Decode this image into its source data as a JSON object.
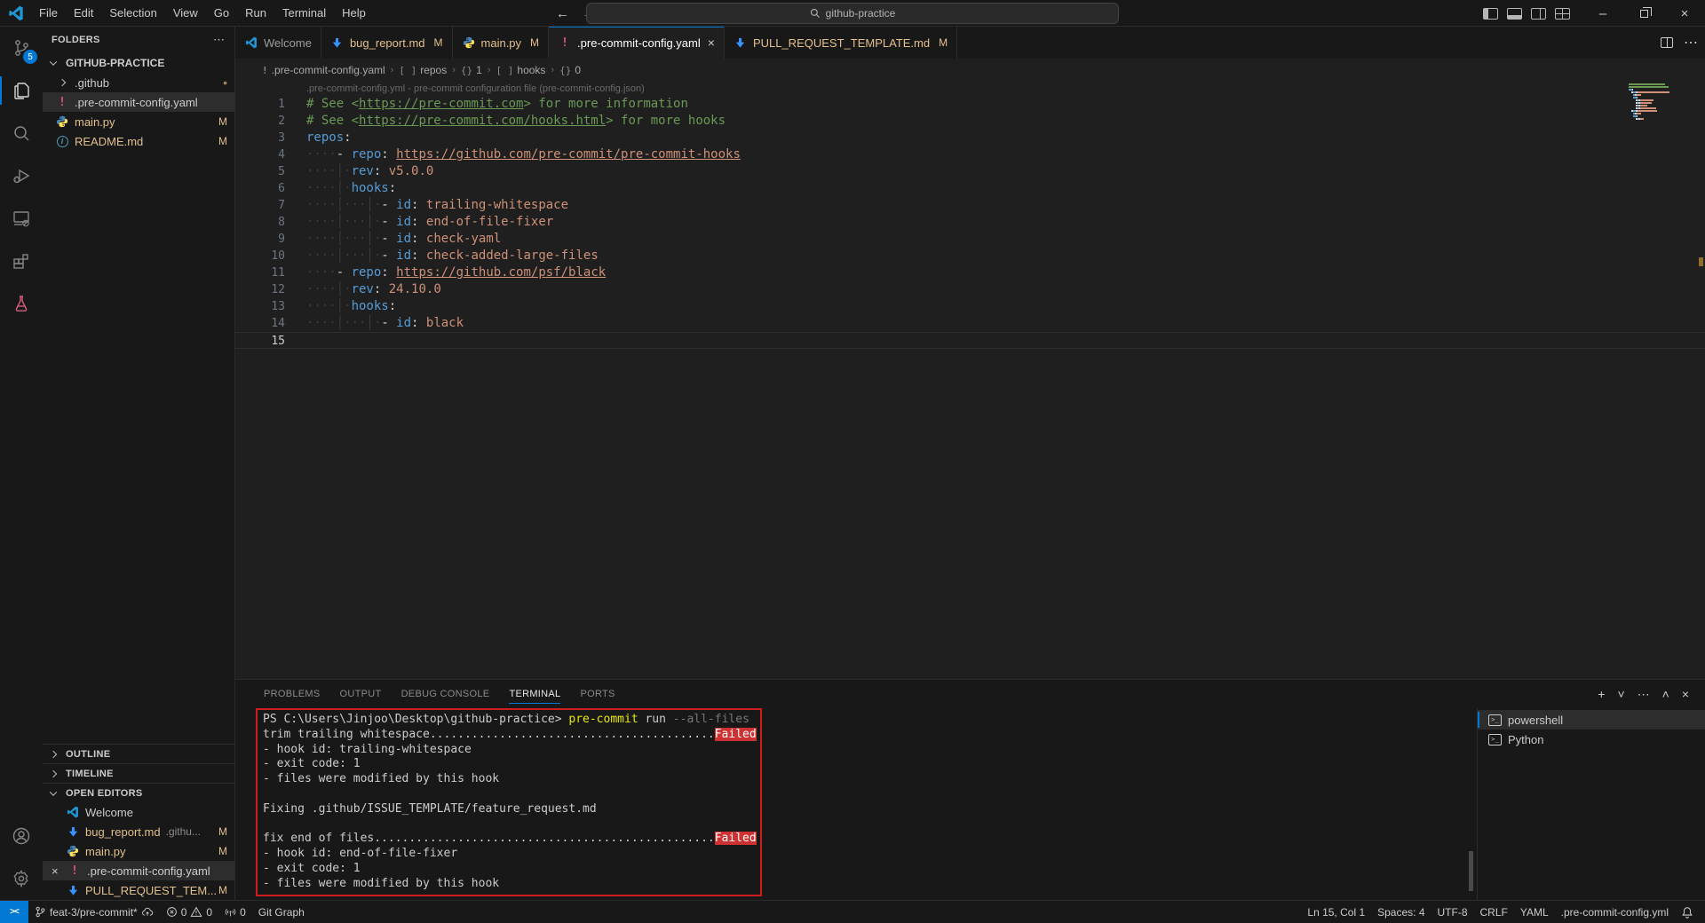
{
  "window": {
    "menus": [
      "File",
      "Edit",
      "Selection",
      "View",
      "Go",
      "Run",
      "Terminal",
      "Help"
    ],
    "search_placeholder": "github-practice",
    "back": "←",
    "forward": "→"
  },
  "activity_bar": {
    "items": [
      {
        "name": "source-control",
        "badge": "5"
      },
      {
        "name": "explorer",
        "active": true
      },
      {
        "name": "search"
      },
      {
        "name": "run-and-debug"
      },
      {
        "name": "remote-explorer"
      },
      {
        "name": "extensions"
      },
      {
        "name": "testing"
      }
    ],
    "bottom": [
      {
        "name": "accounts"
      },
      {
        "name": "settings"
      }
    ]
  },
  "sidebar": {
    "header": "FOLDERS",
    "root": "GITHUB-PRACTICE",
    "files": [
      {
        "label": ".github",
        "icon": "chevron-right",
        "badge": "•",
        "type": "folder"
      },
      {
        "label": ".pre-commit-config.yaml",
        "icon": "warning",
        "selected": true
      },
      {
        "label": "main.py",
        "icon": "python",
        "badge": "M",
        "gold": true
      },
      {
        "label": "README.md",
        "icon": "info",
        "badge": "M",
        "gold": true
      }
    ],
    "sections": [
      "OUTLINE",
      "TIMELINE",
      "OPEN EDITORS"
    ],
    "open_editors": [
      {
        "label": "Welcome",
        "icon": "vscode"
      },
      {
        "label": "bug_report.md",
        "desc": ".githu...",
        "icon": "markdown",
        "badge": "M",
        "gold": true
      },
      {
        "label": "main.py",
        "icon": "python",
        "badge": "M",
        "gold": true
      },
      {
        "label": ".pre-commit-config.yaml",
        "icon": "warning",
        "selected": true,
        "closable": true
      },
      {
        "label": "PULL_REQUEST_TEM...",
        "icon": "markdown",
        "badge": "M",
        "gold": true
      }
    ]
  },
  "tabs": [
    {
      "label": "Welcome",
      "icon": "vscode"
    },
    {
      "label": "bug_report.md",
      "icon": "markdown",
      "badge": "M",
      "gold": true
    },
    {
      "label": "main.py",
      "icon": "python",
      "badge": "M",
      "gold": true
    },
    {
      "label": ".pre-commit-config.yaml",
      "icon": "warning",
      "active": true,
      "closable": true
    },
    {
      "label": "PULL_REQUEST_TEMPLATE.md",
      "icon": "markdown",
      "badge": "M",
      "gold": true
    }
  ],
  "breadcrumb": [
    {
      "sym": "!",
      "label": ".pre-commit-config.yaml"
    },
    {
      "sym": "[ ]",
      "label": "repos"
    },
    {
      "sym": "{}",
      "label": "1"
    },
    {
      "sym": "[ ]",
      "label": "hooks"
    },
    {
      "sym": "{}",
      "label": "0"
    }
  ],
  "editor": {
    "schema_hint": ".pre-commit-config.yml - pre-commit configuration file (pre-commit-config.json)",
    "lines": [
      {
        "num": "1",
        "segs": [
          [
            "comment",
            "# See <"
          ],
          [
            "clink",
            "https://pre-commit.com"
          ],
          [
            "comment",
            "> for more information"
          ]
        ]
      },
      {
        "num": "2",
        "segs": [
          [
            "comment",
            "# See <"
          ],
          [
            "clink",
            "https://pre-commit.com/hooks.html"
          ],
          [
            "comment",
            "> for more hooks"
          ]
        ]
      },
      {
        "num": "3",
        "segs": [
          [
            "key",
            "repos"
          ],
          [
            "punc",
            ":"
          ]
        ]
      },
      {
        "num": "4",
        "segs": [
          [
            "ws",
            "····"
          ],
          [
            "plain",
            "- "
          ],
          [
            "key",
            "repo"
          ],
          [
            "punc",
            ":"
          ],
          [
            "plain",
            " "
          ],
          [
            "slink",
            "https://github.com/pre-commit/pre-commit-hooks"
          ]
        ]
      },
      {
        "num": "5",
        "segs": [
          [
            "ws",
            "····│·"
          ],
          [
            "key",
            "rev"
          ],
          [
            "punc",
            ":"
          ],
          [
            "plain",
            " "
          ],
          [
            "str",
            "v5.0.0"
          ]
        ]
      },
      {
        "num": "6",
        "segs": [
          [
            "ws",
            "····│·"
          ],
          [
            "key",
            "hooks"
          ],
          [
            "punc",
            ":"
          ]
        ]
      },
      {
        "num": "7",
        "segs": [
          [
            "ws",
            "····│···│·"
          ],
          [
            "plain",
            "- "
          ],
          [
            "key",
            "id"
          ],
          [
            "punc",
            ":"
          ],
          [
            "plain",
            " "
          ],
          [
            "str",
            "trailing-whitespace"
          ]
        ]
      },
      {
        "num": "8",
        "segs": [
          [
            "ws",
            "····│···│·"
          ],
          [
            "plain",
            "- "
          ],
          [
            "key",
            "id"
          ],
          [
            "punc",
            ":"
          ],
          [
            "plain",
            " "
          ],
          [
            "str",
            "end-of-file-fixer"
          ]
        ]
      },
      {
        "num": "9",
        "segs": [
          [
            "ws",
            "····│···│·"
          ],
          [
            "plain",
            "- "
          ],
          [
            "key",
            "id"
          ],
          [
            "punc",
            ":"
          ],
          [
            "plain",
            " "
          ],
          [
            "str",
            "check-yaml"
          ]
        ]
      },
      {
        "num": "10",
        "segs": [
          [
            "ws",
            "····│···│·"
          ],
          [
            "plain",
            "- "
          ],
          [
            "key",
            "id"
          ],
          [
            "punc",
            ":"
          ],
          [
            "plain",
            " "
          ],
          [
            "str",
            "check-added-large-files"
          ]
        ]
      },
      {
        "num": "11",
        "segs": [
          [
            "ws",
            "····"
          ],
          [
            "plain",
            "- "
          ],
          [
            "key",
            "repo"
          ],
          [
            "punc",
            ":"
          ],
          [
            "plain",
            " "
          ],
          [
            "slink",
            "https://github.com/psf/black"
          ]
        ]
      },
      {
        "num": "12",
        "segs": [
          [
            "ws",
            "····│·"
          ],
          [
            "key",
            "rev"
          ],
          [
            "punc",
            ":"
          ],
          [
            "plain",
            " "
          ],
          [
            "str",
            "24.10.0"
          ]
        ]
      },
      {
        "num": "13",
        "segs": [
          [
            "ws",
            "····│·"
          ],
          [
            "key",
            "hooks"
          ],
          [
            "punc",
            ":"
          ]
        ]
      },
      {
        "num": "14",
        "segs": [
          [
            "ws",
            "····│···│·"
          ],
          [
            "plain",
            "- "
          ],
          [
            "key",
            "id"
          ],
          [
            "punc",
            ":"
          ],
          [
            "plain",
            " "
          ],
          [
            "str",
            "black"
          ]
        ]
      },
      {
        "num": "15",
        "segs": [],
        "current": true
      }
    ]
  },
  "panel": {
    "tabs": [
      {
        "label": "PROBLEMS"
      },
      {
        "label": "OUTPUT"
      },
      {
        "label": "DEBUG CONSOLE"
      },
      {
        "label": "TERMINAL",
        "active": true
      },
      {
        "label": "PORTS"
      }
    ],
    "actions": {
      "new": "+",
      "dropdown": "˅",
      "more": "⋯",
      "maximize": "˄",
      "close": "×"
    },
    "line_width": 71,
    "terminal_lines": [
      {
        "segs": [
          [
            "plain",
            "PS C:\\Users\\Jinjoo\\Desktop\\github-practice> "
          ],
          [
            "cmd",
            "pre-commit"
          ],
          [
            "plain",
            " run "
          ],
          [
            "flag",
            "--all-files"
          ]
        ]
      },
      {
        "text": "trim trailing whitespace",
        "fill": true,
        "status": "Failed"
      },
      {
        "text": "- hook id: trailing-whitespace"
      },
      {
        "text": "- exit code: 1"
      },
      {
        "text": "- files were modified by this hook"
      },
      {
        "text": ""
      },
      {
        "text": "Fixing .github/ISSUE_TEMPLATE/feature_request.md"
      },
      {
        "text": ""
      },
      {
        "text": "fix end of files",
        "fill": true,
        "status": "Failed"
      },
      {
        "text": "- hook id: end-of-file-fixer"
      },
      {
        "text": "- exit code: 1"
      },
      {
        "text": "- files were modified by this hook"
      }
    ],
    "terminals": [
      {
        "label": "powershell",
        "selected": true
      },
      {
        "label": "Python"
      }
    ]
  },
  "statusbar": {
    "remote": "><",
    "branch": "feat-3/pre-commit*",
    "errors": "0",
    "warnings": "0",
    "ports": "0",
    "git_graph": "Git Graph",
    "cursor": "Ln 15, Col 1",
    "indent": "Spaces: 4",
    "encoding": "UTF-8",
    "eol": "CRLF",
    "language": "YAML",
    "schema": ".pre-commit-config.yml"
  },
  "colors": {
    "accent": "#0078d4",
    "modified": "#e2c08d",
    "failed_bg": "#cd3131",
    "annotation": "#cf1d1d",
    "comment": "#6a9955",
    "key": "#569cd6",
    "string": "#ce9178"
  }
}
